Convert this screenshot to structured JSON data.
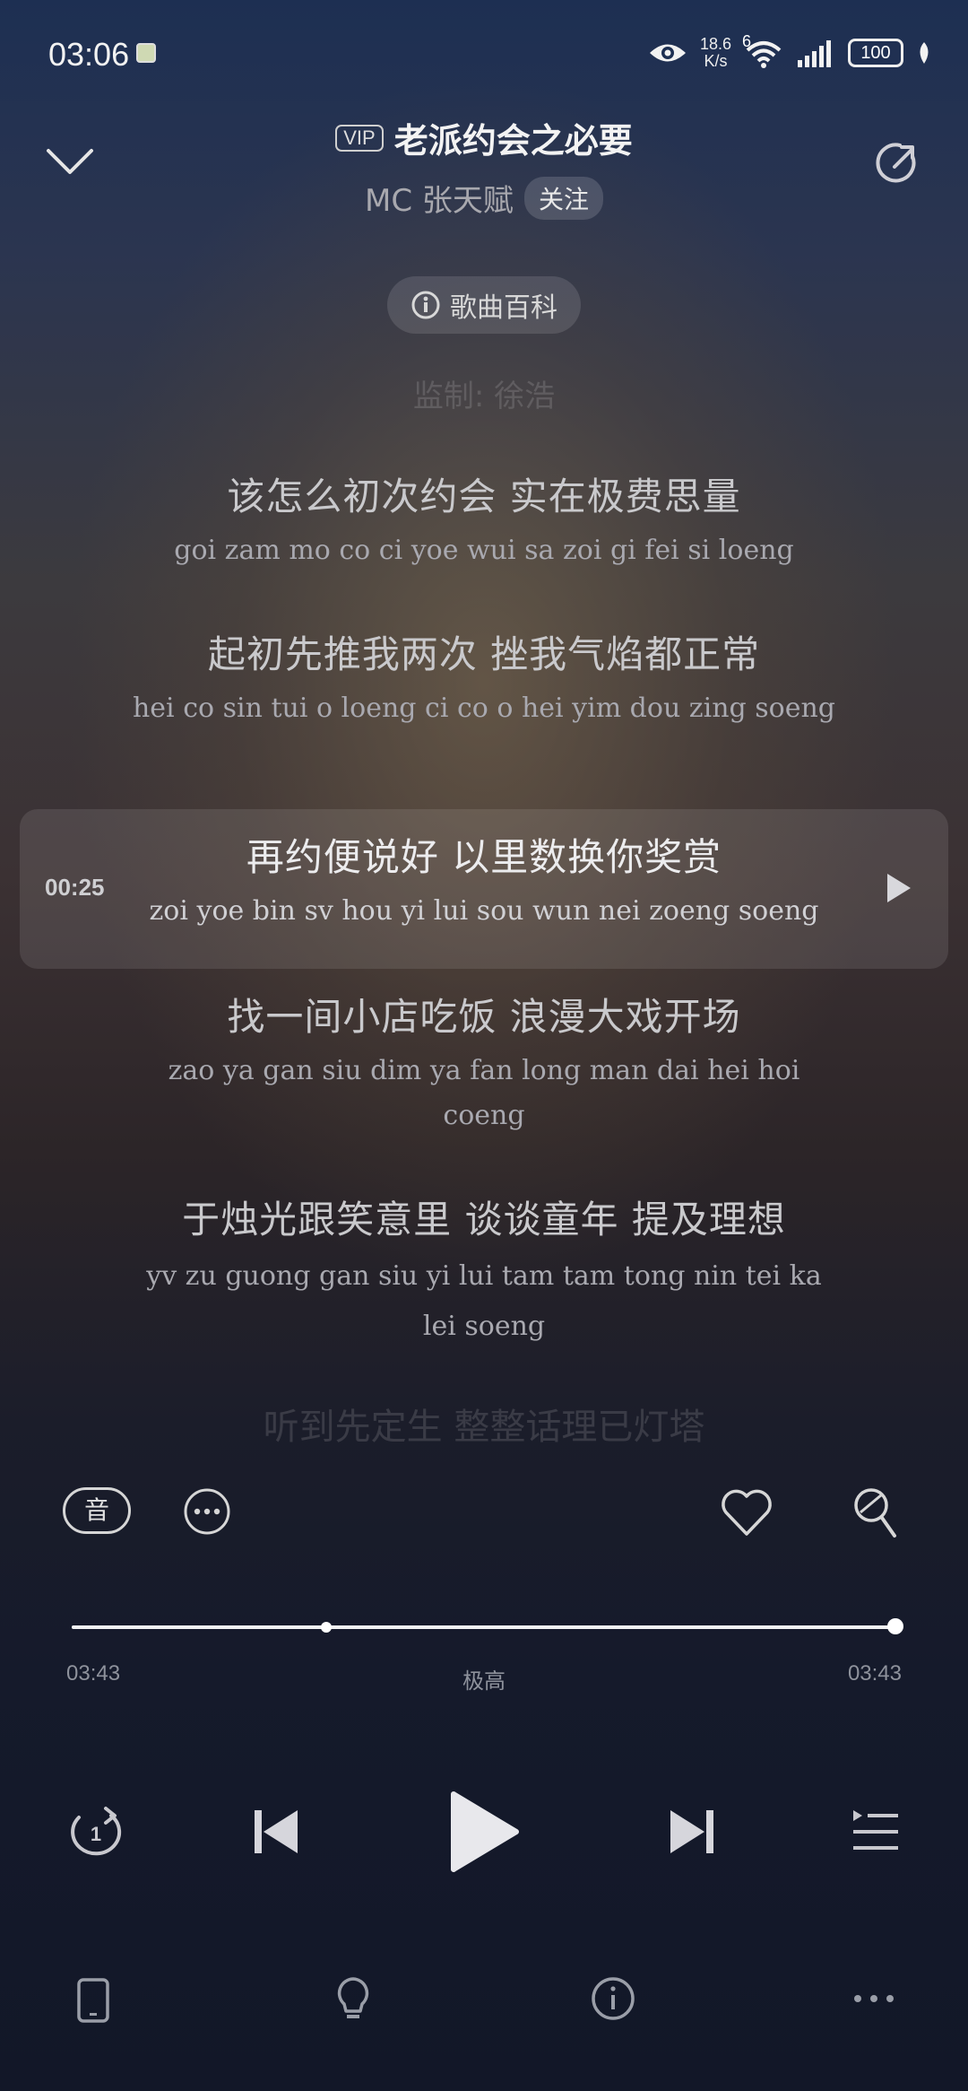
{
  "status_bar": {
    "time": "03:06",
    "net_speed_value": "18.6",
    "net_speed_unit": "K/s",
    "wifi_label": "6",
    "battery": "100"
  },
  "header": {
    "vip_badge": "VIP",
    "title": "老派约会之必要",
    "artist": "MC 张天赋",
    "follow_label": "关注"
  },
  "wiki": {
    "label": "歌曲百科"
  },
  "lyrics": {
    "faded_top": "监制: 徐浩",
    "lines": [
      {
        "zh": "该怎么初次约会 实在极费思量",
        "jp": "goi zam mo co ci yoe wui sa zoi gi fei si loeng"
      },
      {
        "zh": "起初先推我两次 挫我气焰都正常",
        "jp": "hei co sin tui o loeng ci co o hei yim dou zing soeng"
      },
      {
        "zh": "再约便说好 以里数换你奖赏",
        "jp": "zoi yoe bin sv hou yi lui sou wun nei zoeng soeng",
        "current": true,
        "time": "00:25"
      },
      {
        "zh": "找一间小店吃饭 浪漫大戏开场",
        "jp": "zao ya gan siu dim ya fan long man dai hei hoi coeng"
      },
      {
        "zh": "于烛光跟笑意里 谈谈童年 提及理想",
        "jp": "yv zu guong gan siu yi lui tam tam tong nin tei ka lei soeng"
      }
    ],
    "faded_bottom": "听到先定生 整整话理已灯塔"
  },
  "actions": {
    "sound_label": "音"
  },
  "player": {
    "elapsed": "03:43",
    "duration": "03:43",
    "quality": "极高",
    "progress_fraction": 1.0,
    "buffer_marker_fraction": 0.31
  },
  "colors": {
    "accent": "#ffffff",
    "muted": "#8e929c"
  }
}
